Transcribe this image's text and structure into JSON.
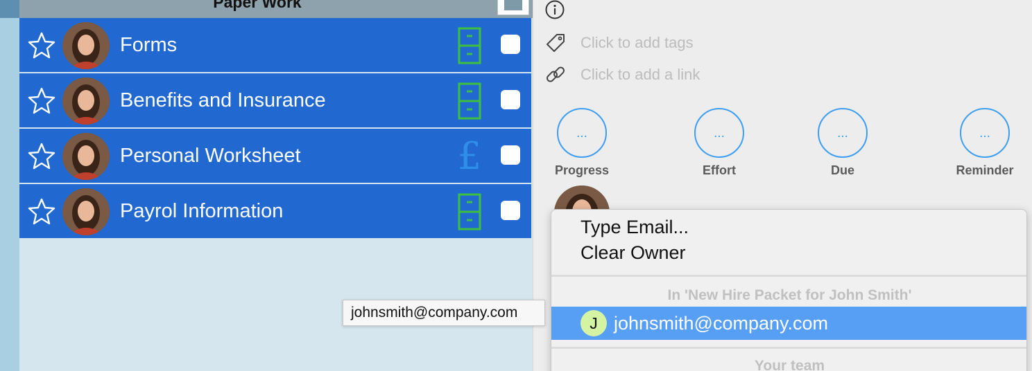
{
  "list": {
    "group_title": "Paper Work",
    "rows": [
      {
        "label": "Forms",
        "type_icon": "file-cabinet-icon"
      },
      {
        "label": "Benefits and Insurance",
        "type_icon": "file-cabinet-icon"
      },
      {
        "label": "Personal Worksheet",
        "type_icon": "pound-icon",
        "type_glyph": "£"
      },
      {
        "label": "Payrol Information",
        "type_icon": "file-cabinet-icon"
      }
    ]
  },
  "details": {
    "tags_placeholder": "Click to add tags",
    "link_placeholder": "Click to add a link",
    "metrics": [
      {
        "label": "Progress",
        "value": "..."
      },
      {
        "label": "Effort",
        "value": "..."
      },
      {
        "label": "Due",
        "value": "..."
      },
      {
        "label": "Reminder",
        "value": "..."
      }
    ]
  },
  "owner_menu": {
    "type_email": "Type Email...",
    "clear_owner": "Clear Owner",
    "section_project": "In 'New Hire Packet for John Smith'",
    "selected_initial": "J",
    "selected_email": "johnsmith@company.com",
    "section_team": "Your team"
  },
  "tooltip": {
    "text": "johnsmith@company.com"
  },
  "colors": {
    "row_selected": "#2169d1",
    "accent": "#3d9ef1",
    "cabinet": "#3fbf3f",
    "menu_highlight": "#579ff4"
  }
}
